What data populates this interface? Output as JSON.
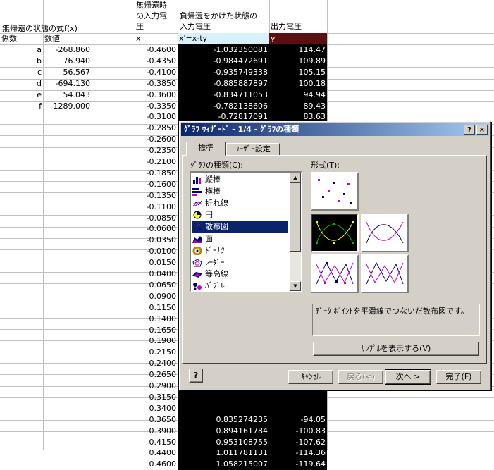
{
  "sheet": {
    "left_header": {
      "title": "無帰還の状態の式f(x)",
      "col1": "係数",
      "col2": "数値"
    },
    "coefficients": [
      {
        "name": "a",
        "value": "-268.860"
      },
      {
        "name": "b",
        "value": "76.940"
      },
      {
        "name": "c",
        "value": "56.567"
      },
      {
        "name": "d",
        "value": "-694.130"
      },
      {
        "name": "e",
        "value": "54.043"
      },
      {
        "name": "f",
        "value": "1289.000"
      }
    ],
    "col_x_header": [
      "無帰還時",
      "の入力電",
      "圧"
    ],
    "col_x_sub": "x",
    "col_xp_header": [
      "負帰還をかけた状態の",
      "入力電圧"
    ],
    "col_xp_sub": "x'=x-ty",
    "col_y_header": "出力電圧",
    "col_y_sub": "y",
    "x_values": [
      "-0.4600",
      "-0.4350",
      "-0.4100",
      "-0.3850",
      "-0.3600",
      "-0.3350",
      "-0.3100",
      "-0.2850",
      "-0.2600",
      "-0.2350",
      "-0.2100",
      "-0.1850",
      "-0.1600",
      "-0.1350",
      "-0.1100",
      "-0.0850",
      "-0.0600",
      "-0.0350",
      "-0.0100",
      "0.0150",
      "0.0400",
      "0.0650",
      "0.0900",
      "0.1150",
      "0.1400",
      "0.1650",
      "0.1900",
      "0.2150",
      "0.2400",
      "0.2650",
      "0.2900",
      "0.3150",
      "0.3400",
      "0.3650",
      "0.3900",
      "0.4150",
      "0.4400",
      "0.4600"
    ],
    "xp_top": [
      "-1.032350081",
      "-0.984472691",
      "-0.935749338",
      "-0.885887897",
      "-0.834711053",
      "-0.782138606",
      "-0.72817091"
    ],
    "y_top": [
      "114.47",
      "109.89",
      "105.15",
      "100.18",
      "94.94",
      "89.43",
      "83.63"
    ],
    "xp_bottom": [
      "0.835274235",
      "0.894161784",
      "0.953108755",
      "1.011781131",
      "1.058215007"
    ],
    "y_bottom": [
      "-94.05",
      "-100.83",
      "-107.62",
      "-114.36",
      "-119.64"
    ]
  },
  "dialog": {
    "title": "ｸﾞﾗﾌ ｳｨｻﾞｰﾄﾞ - 1/4 - ｸﾞﾗﾌの種類",
    "help_btn": "?",
    "close_btn": "×",
    "tabs": [
      "標準",
      "ﾕｰｻﾞｰ設定"
    ],
    "chart_type_label": "ｸﾞﾗﾌの種類(C):",
    "subtype_label": "形式(T):",
    "chart_types": [
      {
        "label": "縦棒",
        "icon": "column-chart-icon"
      },
      {
        "label": "横棒",
        "icon": "bar-chart-icon"
      },
      {
        "label": "折れ線",
        "icon": "line-chart-icon"
      },
      {
        "label": "円",
        "icon": "pie-chart-icon"
      },
      {
        "label": "散布図",
        "icon": "scatter-chart-icon"
      },
      {
        "label": "面",
        "icon": "area-chart-icon"
      },
      {
        "label": "ﾄﾞｰﾅﾂ",
        "icon": "doughnut-chart-icon"
      },
      {
        "label": "ﾚｰﾀﾞｰ",
        "icon": "radar-chart-icon"
      },
      {
        "label": "等高線",
        "icon": "surface-chart-icon"
      },
      {
        "label": "ﾊﾞﾌﾞﾙ",
        "icon": "bubble-chart-icon"
      }
    ],
    "selected_type_index": 4,
    "description": "ﾃﾞｰﾀ ﾎﾟｲﾝﾄを平滑線でつないだ散布図です。",
    "preview_btn": "ｻﾝﾌﾟﾙを表示する(V)",
    "cancel_btn": "ｷｬﾝｾﾙ",
    "back_btn": "戻る(<)",
    "next_btn": "次へ >",
    "finish_btn": "完了(F)"
  }
}
